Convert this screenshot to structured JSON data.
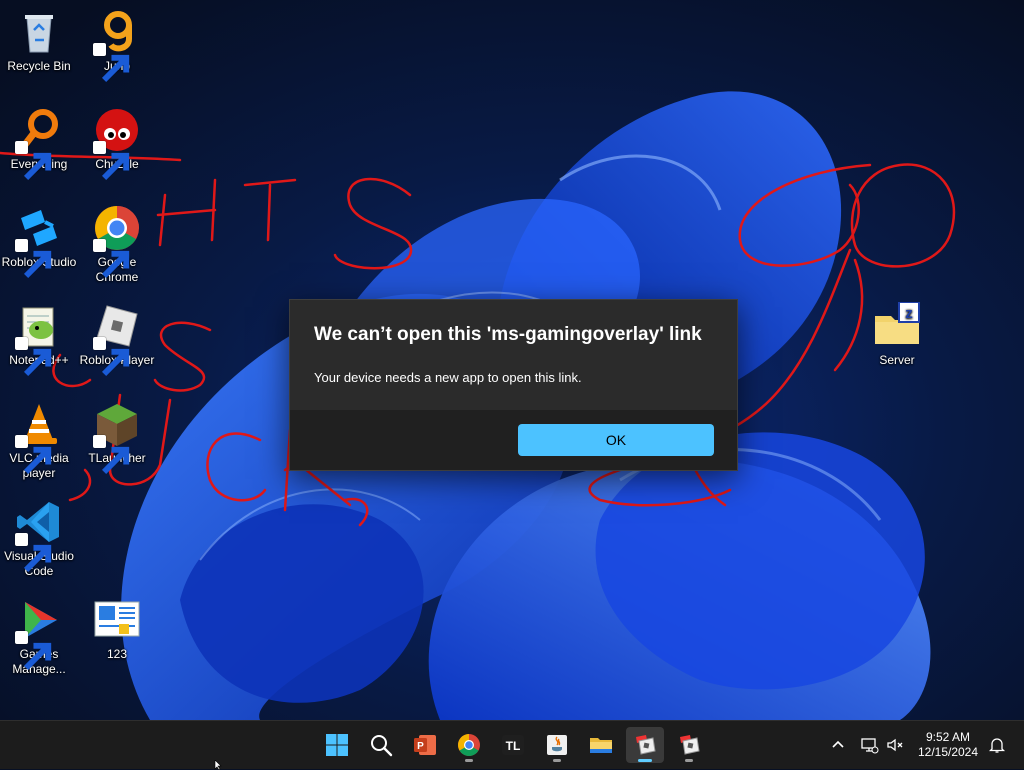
{
  "desktop": {
    "icons": [
      {
        "label": "Recycle Bin",
        "icon": "recycle-bin-icon"
      },
      {
        "label": "Juno",
        "icon": "juno-icon"
      },
      {
        "label": "Everything",
        "icon": "everything-search-icon"
      },
      {
        "label": "Chuzzle",
        "icon": "chuzzle-icon"
      },
      {
        "label": "Roblox Studio",
        "icon": "roblox-studio-icon"
      },
      {
        "label": "Google Chrome",
        "icon": "chrome-icon"
      },
      {
        "label": "Notepad++",
        "icon": "notepad-plus-plus-icon"
      },
      {
        "label": "Roblox Player",
        "icon": "roblox-player-icon"
      },
      {
        "label": "VLC media player",
        "icon": "vlc-icon"
      },
      {
        "label": "TLauncher",
        "icon": "tlauncher-icon"
      },
      {
        "label": "Visual Studio Code",
        "icon": "vscode-icon"
      },
      {
        "label": "Games Manage...",
        "icon": "games-manager-icon"
      },
      {
        "label": "123",
        "icon": "document-icon"
      },
      {
        "label": "Server",
        "icon": "folder-zip-icon"
      }
    ]
  },
  "dialog": {
    "title": "We can’t open this 'ms-gamingoverlay' link",
    "message": "Your device needs a new app to open this link.",
    "ok_label": "OK"
  },
  "taskbar": {
    "apps": [
      {
        "name": "start-button",
        "icon": "windows-logo-icon"
      },
      {
        "name": "search-button",
        "icon": "search-icon"
      },
      {
        "name": "powerpoint",
        "icon": "powerpoint-icon"
      },
      {
        "name": "chrome",
        "icon": "chrome-icon"
      },
      {
        "name": "tlauncher",
        "icon": "tlauncher-icon"
      },
      {
        "name": "java",
        "icon": "java-icon"
      },
      {
        "name": "file-explorer",
        "icon": "folder-icon"
      },
      {
        "name": "roblox-studio",
        "icon": "roblox-studio-icon",
        "active": true
      },
      {
        "name": "roblox-player",
        "icon": "roblox-player-icon"
      }
    ],
    "clock": {
      "time": "9:52 AM",
      "date": "12/15/2024"
    }
  },
  "colors": {
    "accent": "#4cc2ff",
    "scribble": "#e01818",
    "taskbar": "#1c1c1c",
    "dialog": "#2b2b2b"
  }
}
